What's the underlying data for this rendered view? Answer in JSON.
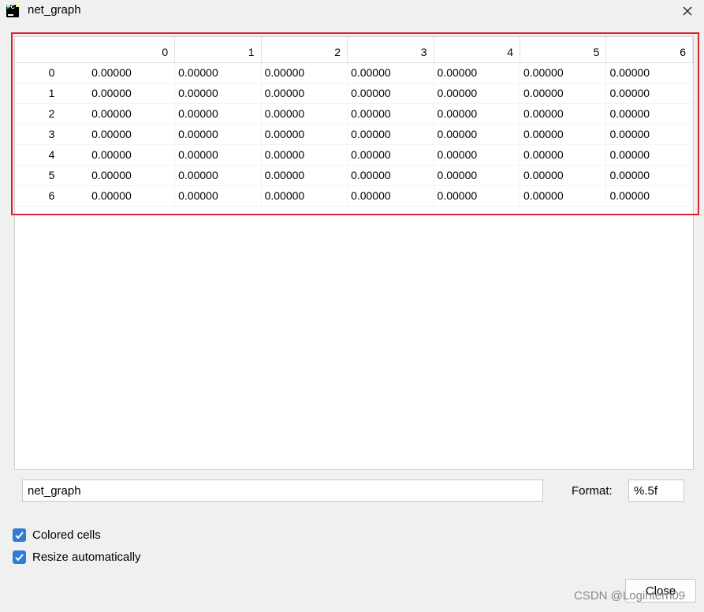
{
  "window": {
    "title": "net_graph",
    "icon_text": "PC"
  },
  "table": {
    "columns": [
      "0",
      "1",
      "2",
      "3",
      "4",
      "5",
      "6"
    ],
    "rows": [
      {
        "label": "0",
        "cells": [
          "0.00000",
          "0.00000",
          "0.00000",
          "0.00000",
          "0.00000",
          "0.00000",
          "0.00000"
        ]
      },
      {
        "label": "1",
        "cells": [
          "0.00000",
          "0.00000",
          "0.00000",
          "0.00000",
          "0.00000",
          "0.00000",
          "0.00000"
        ]
      },
      {
        "label": "2",
        "cells": [
          "0.00000",
          "0.00000",
          "0.00000",
          "0.00000",
          "0.00000",
          "0.00000",
          "0.00000"
        ]
      },
      {
        "label": "3",
        "cells": [
          "0.00000",
          "0.00000",
          "0.00000",
          "0.00000",
          "0.00000",
          "0.00000",
          "0.00000"
        ]
      },
      {
        "label": "4",
        "cells": [
          "0.00000",
          "0.00000",
          "0.00000",
          "0.00000",
          "0.00000",
          "0.00000",
          "0.00000"
        ]
      },
      {
        "label": "5",
        "cells": [
          "0.00000",
          "0.00000",
          "0.00000",
          "0.00000",
          "0.00000",
          "0.00000",
          "0.00000"
        ]
      },
      {
        "label": "6",
        "cells": [
          "0.00000",
          "0.00000",
          "0.00000",
          "0.00000",
          "0.00000",
          "0.00000",
          "0.00000"
        ]
      }
    ]
  },
  "footer": {
    "name_value": "net_graph",
    "format_label": "Format:",
    "format_value": "%.5f",
    "colored_cells_label": "Colored cells",
    "colored_cells_checked": true,
    "resize_label": "Resize automatically",
    "resize_checked": true,
    "close_label": "Close"
  },
  "watermark": "CSDN @Logintern09",
  "colors": {
    "highlight": "#d9232f",
    "checkbox": "#2f7bd6"
  },
  "icons": [
    "pycharm-icon",
    "close-icon",
    "checkmark-icon"
  ]
}
